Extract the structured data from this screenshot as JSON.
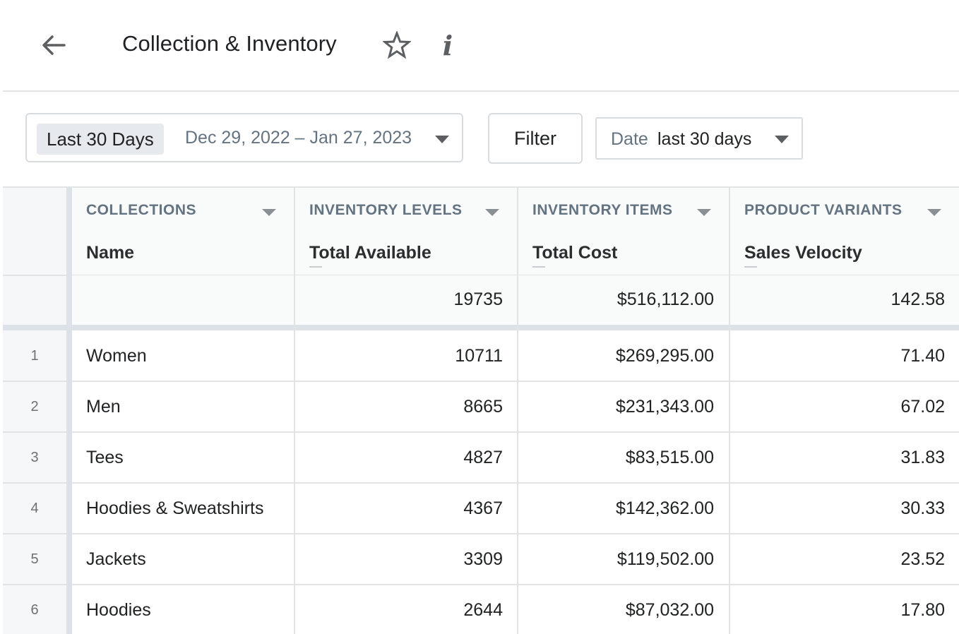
{
  "header": {
    "title": "Collection & Inventory",
    "back_icon": "arrow-left-icon",
    "star_icon": "star-outline-icon",
    "info_icon": "info-italic-icon",
    "info_glyph": "i"
  },
  "toolbar": {
    "date_preset": "Last 30 Days",
    "date_range": "Dec 29, 2022 – Jan 27, 2023",
    "filter_label": "Filter",
    "date_filter_label": "Date",
    "date_filter_value": "last 30 days"
  },
  "table": {
    "columns": [
      {
        "group": "COLLECTIONS",
        "label": "Name"
      },
      {
        "group": "INVENTORY LEVELS",
        "label": "Total Available"
      },
      {
        "group": "INVENTORY ITEMS",
        "label": "Total Cost"
      },
      {
        "group": "PRODUCT VARIANTS",
        "label": "Sales Velocity"
      }
    ],
    "totals": [
      "",
      "19735",
      "$516,112.00",
      "142.58"
    ],
    "rows": [
      {
        "n": "1",
        "name": "Women",
        "available": "10711",
        "cost": "$269,295.00",
        "velocity": "71.40"
      },
      {
        "n": "2",
        "name": "Men",
        "available": "8665",
        "cost": "$231,343.00",
        "velocity": "67.02"
      },
      {
        "n": "3",
        "name": "Tees",
        "available": "4827",
        "cost": "$83,515.00",
        "velocity": "31.83"
      },
      {
        "n": "4",
        "name": "Hoodies & Sweatshirts",
        "available": "4367",
        "cost": "$142,362.00",
        "velocity": "30.33"
      },
      {
        "n": "5",
        "name": "Jackets",
        "available": "3309",
        "cost": "$119,502.00",
        "velocity": "23.52"
      },
      {
        "n": "6",
        "name": "Hoodies",
        "available": "2644",
        "cost": "$87,032.00",
        "velocity": "17.80"
      }
    ]
  },
  "colors": {
    "header_text": "#637381",
    "freeze_bar": "#dde1e8",
    "chip_bg": "#e6e9ed"
  }
}
